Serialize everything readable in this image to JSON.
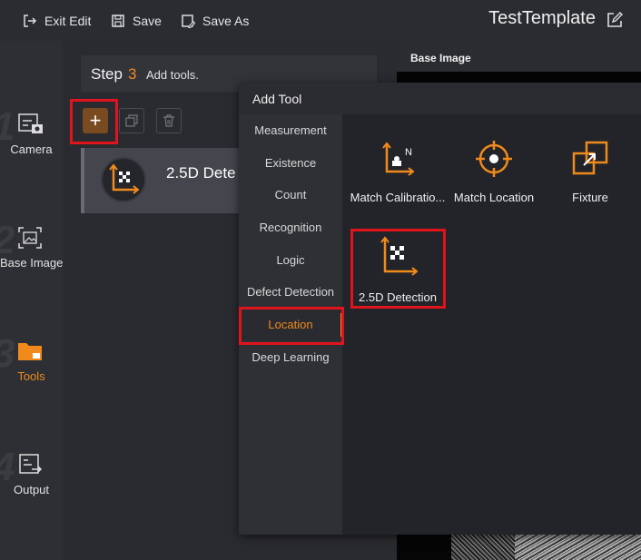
{
  "toolbar": {
    "exit_edit": "Exit Edit",
    "save": "Save",
    "save_as": "Save As",
    "template_title": "TestTemplate"
  },
  "rail": {
    "items": [
      {
        "num": "1",
        "label": "Camera",
        "icon": "camera-icon"
      },
      {
        "num": "2",
        "label": "Base Image",
        "icon": "base-image-icon"
      },
      {
        "num": "3",
        "label": "Tools",
        "icon": "folder-icon",
        "active": true
      },
      {
        "num": "4",
        "label": "Output",
        "icon": "output-icon"
      }
    ]
  },
  "step": {
    "word": "Step",
    "number": "3",
    "description": "Add tools."
  },
  "tool_card": {
    "name": "2.5D Dete"
  },
  "base_image": {
    "title": "Base Image"
  },
  "dialog": {
    "title": "Add Tool",
    "categories": [
      "Measurement",
      "Existence",
      "Count",
      "Recognition",
      "Logic",
      "Defect Detection",
      "Location",
      "Deep Learning"
    ],
    "active_category": "Location",
    "tools": [
      {
        "label": "Match Calibratio...",
        "icon": "match-calibration-icon"
      },
      {
        "label": "Match Location",
        "icon": "match-location-icon"
      },
      {
        "label": "Fixture",
        "icon": "fixture-icon"
      },
      {
        "label": "2.5D Detection",
        "icon": "2-5d-detection-icon"
      }
    ]
  },
  "colors": {
    "accent": "#f08a1c",
    "highlight": "#e0141c"
  }
}
